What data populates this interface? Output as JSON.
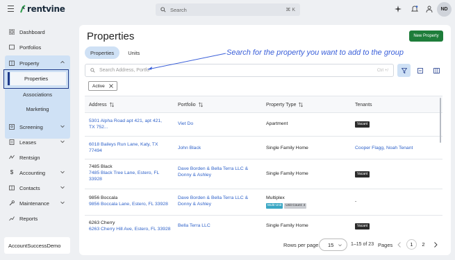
{
  "topbar": {
    "logo_text": "rentvine",
    "search_placeholder": "Search",
    "search_shortcut": "⌘ K",
    "avatar_initials": "ND"
  },
  "sidebar": {
    "items": [
      {
        "label": "Dashboard",
        "icon": "grid-icon"
      },
      {
        "label": "Portfolios",
        "icon": "folder-icon"
      },
      {
        "label": "Property",
        "icon": "building-icon"
      },
      {
        "label": "Screening",
        "icon": "screening-icon"
      },
      {
        "label": "Leases",
        "icon": "lease-icon"
      },
      {
        "label": "Rentsign",
        "icon": "rentsign-icon"
      },
      {
        "label": "Accounting",
        "icon": "dollar-icon"
      },
      {
        "label": "Contacts",
        "icon": "contacts-icon"
      },
      {
        "label": "Maintenance",
        "icon": "wrench-icon"
      },
      {
        "label": "Reports",
        "icon": "reports-icon"
      }
    ],
    "property_sub": [
      "Properties",
      "Associations",
      "Marketing"
    ],
    "account_name": "AccountSuccessDemo"
  },
  "main": {
    "title": "Properties",
    "new_button": "New Property",
    "tabs": [
      "Properties",
      "Units"
    ],
    "annotation": "Search for the property you want to add to the group",
    "search_placeholder": "Search Address, Portfo",
    "search_hint": "Ctrl +/",
    "filter_chip": "Active",
    "columns": [
      "Address",
      "Portfolio",
      "Property Type",
      "Tenants"
    ],
    "rows": [
      {
        "name": "",
        "address": "5301 Alpha Road apt 421, apt 421, TX 752...",
        "portfolio": "Viet Do",
        "type": "Apartment",
        "tags": [],
        "tenants": "",
        "badge": "Vacant"
      },
      {
        "name": "",
        "address": "6018 Baileys Run Lane, Katy, TX 77494",
        "portfolio": "John Black",
        "type": "Single Family Home",
        "tags": [],
        "tenants": "Cooper Flagg, Noah Tenant",
        "badge": ""
      },
      {
        "name": "7485 Black",
        "address": "7485 Black Tree Lane, Estero, FL 33928",
        "portfolio": "Dave Borden & Bella Terra LLC & Donny & Ashley",
        "type": "Single Family Home",
        "tags": [],
        "tenants": "",
        "badge": "Vacant"
      },
      {
        "name": "9856 Boccala",
        "address": "9856 Boccala Lane, Estero, FL 33928",
        "portfolio": "Dave Borden & Bella Terra LLC & Donny & Ashley",
        "type": "Multiplex",
        "tags": [
          "Multi-Unit",
          "Unit Count: 4"
        ],
        "tenants": "-",
        "badge": ""
      },
      {
        "name": "6263 Cherry",
        "address": "6263 Cherry Hill Ave, Estero, FL 33928",
        "portfolio": "Bella Terra LLC",
        "type": "Single Family Home",
        "tags": [],
        "tenants": "",
        "badge": "Vacant"
      }
    ],
    "footer": {
      "rows_per_page_label": "Rows per page:",
      "rows_per_page_value": "15",
      "range": "1–15 of 23",
      "pages_label": "Pages",
      "pages": [
        "1",
        "2"
      ]
    }
  },
  "colors": {
    "accent": "#1e3a8a",
    "brand_green": "#1e7d3a",
    "link": "#2f62c9",
    "sidebar_highlight": "#cfe1f5",
    "annotation": "#3a5fd9"
  }
}
